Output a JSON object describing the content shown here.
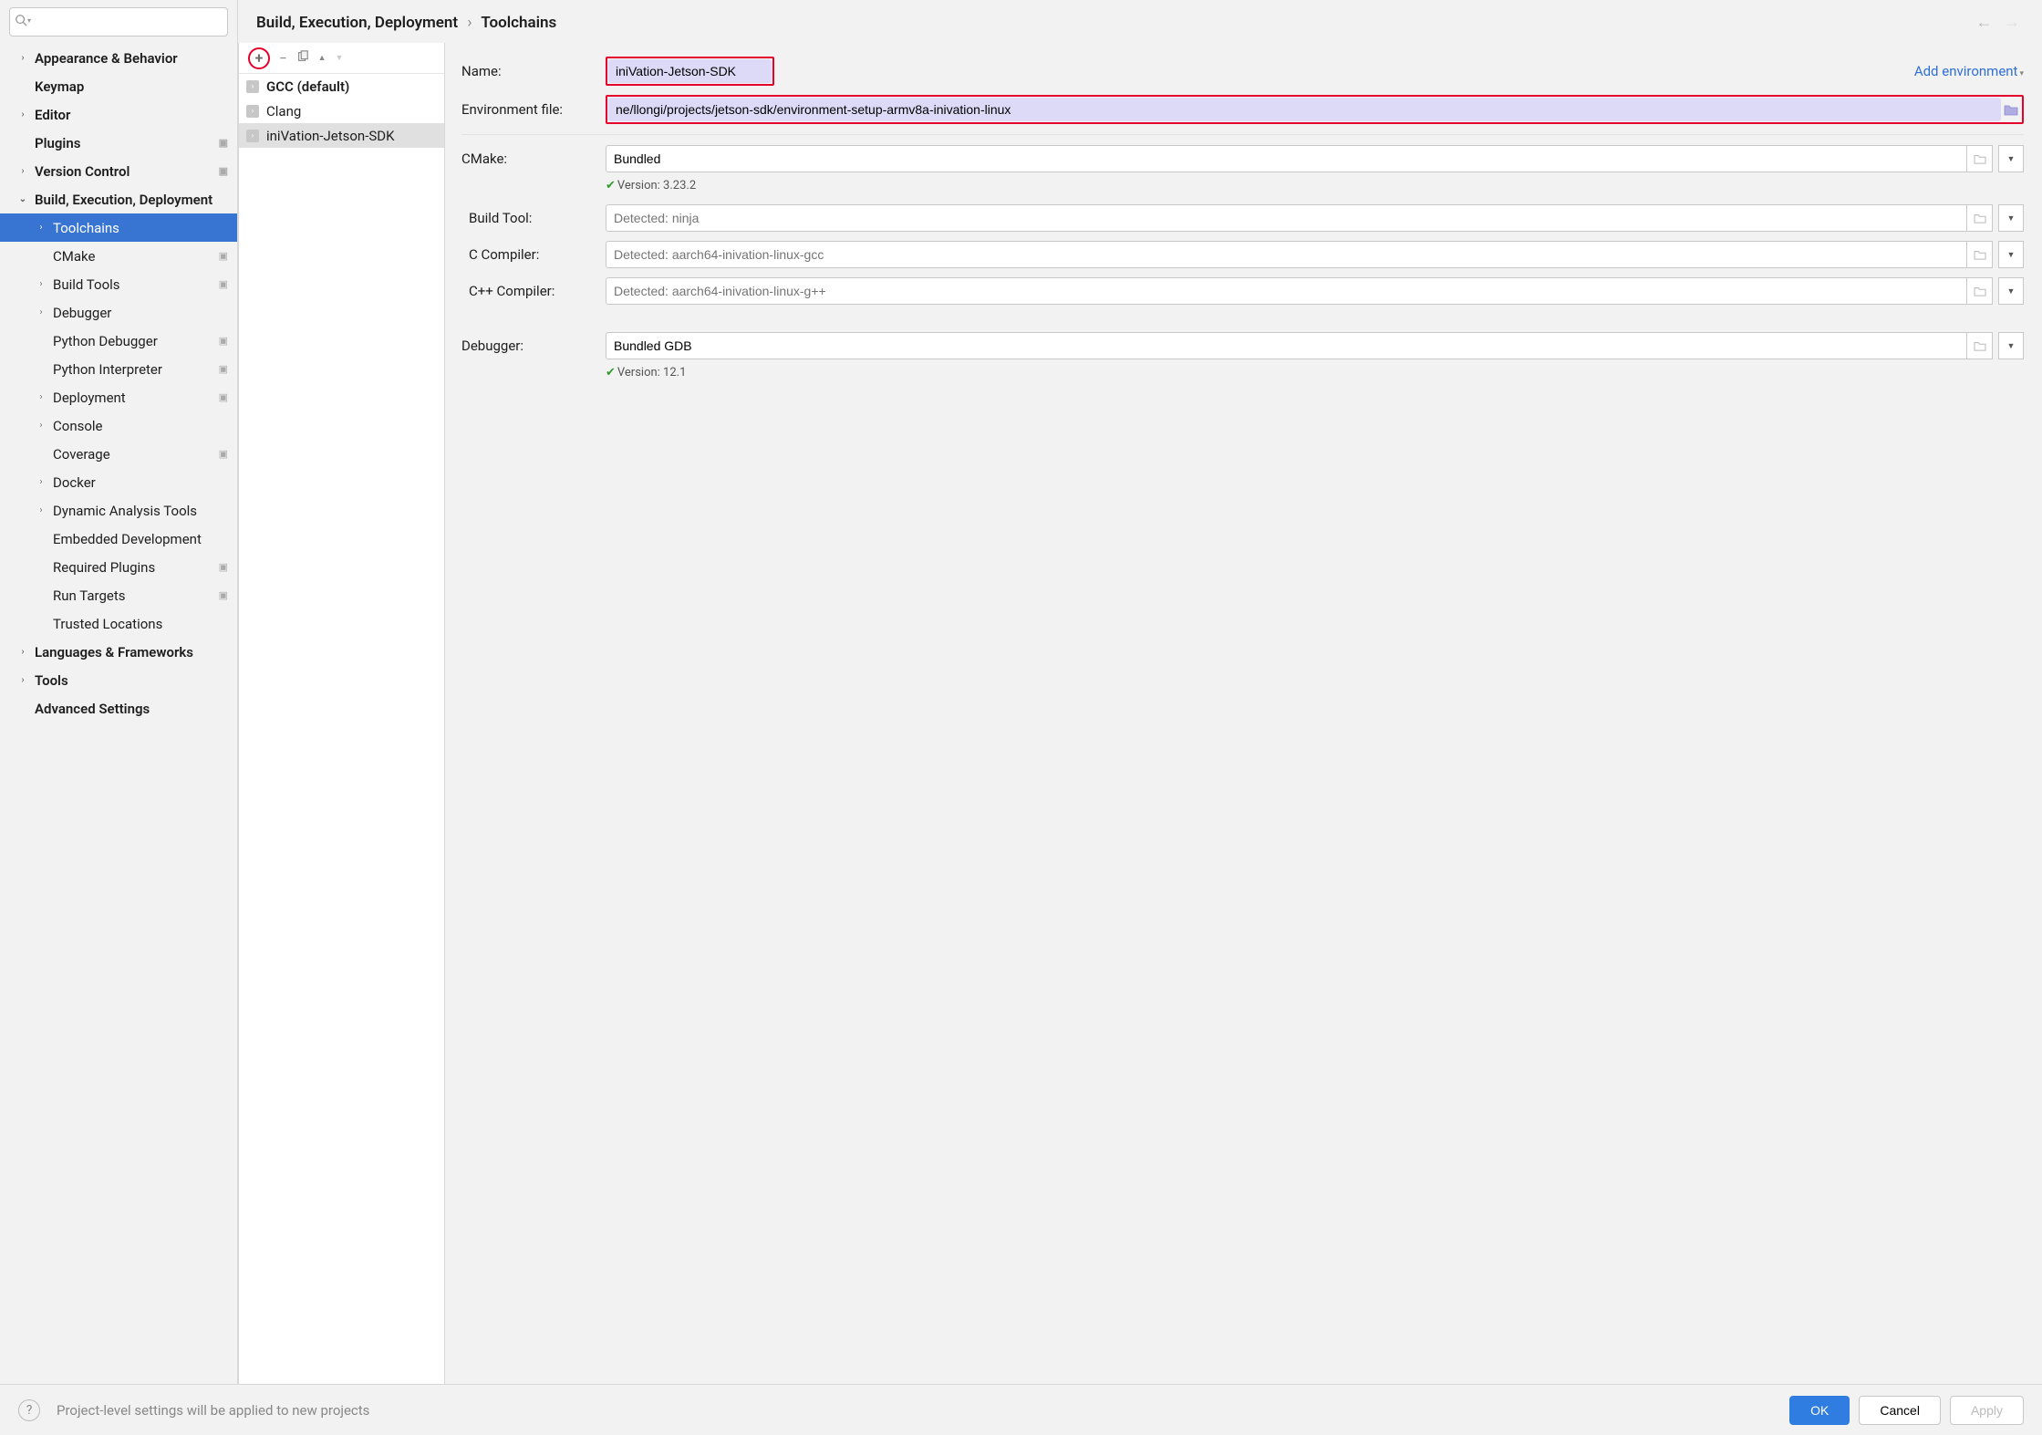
{
  "breadcrumb": {
    "group": "Build, Execution, Deployment",
    "page": "Toolchains"
  },
  "sidebar": {
    "items": [
      {
        "label": "Appearance & Behavior",
        "bold": true,
        "chev": ">"
      },
      {
        "label": "Keymap",
        "bold": true
      },
      {
        "label": "Editor",
        "bold": true,
        "chev": ">"
      },
      {
        "label": "Plugins",
        "bold": true,
        "cfg": true
      },
      {
        "label": "Version Control",
        "bold": true,
        "chev": ">",
        "cfg": true
      },
      {
        "label": "Build, Execution, Deployment",
        "bold": true,
        "chev": "v"
      },
      {
        "label": "Toolchains",
        "nested": true,
        "chev": ">",
        "selected": true
      },
      {
        "label": "CMake",
        "nested": true,
        "cfg": true
      },
      {
        "label": "Build Tools",
        "nested": true,
        "chev": ">",
        "cfg": true
      },
      {
        "label": "Debugger",
        "nested": true,
        "chev": ">"
      },
      {
        "label": "Python Debugger",
        "nested": true,
        "cfg": true
      },
      {
        "label": "Python Interpreter",
        "nested": true,
        "cfg": true
      },
      {
        "label": "Deployment",
        "nested": true,
        "chev": ">",
        "cfg": true
      },
      {
        "label": "Console",
        "nested": true,
        "chev": ">"
      },
      {
        "label": "Coverage",
        "nested": true,
        "cfg": true
      },
      {
        "label": "Docker",
        "nested": true,
        "chev": ">"
      },
      {
        "label": "Dynamic Analysis Tools",
        "nested": true,
        "chev": ">"
      },
      {
        "label": "Embedded Development",
        "nested": true
      },
      {
        "label": "Required Plugins",
        "nested": true,
        "cfg": true
      },
      {
        "label": "Run Targets",
        "nested": true,
        "cfg": true
      },
      {
        "label": "Trusted Locations",
        "nested": true
      },
      {
        "label": "Languages & Frameworks",
        "bold": true,
        "chev": ">"
      },
      {
        "label": "Tools",
        "bold": true,
        "chev": ">"
      },
      {
        "label": "Advanced Settings",
        "bold": true
      }
    ]
  },
  "toolchains": {
    "items": [
      {
        "label": "GCC (default)",
        "default": true
      },
      {
        "label": "Clang"
      },
      {
        "label": "iniVation-Jetson-SDK",
        "selected": true
      }
    ]
  },
  "form": {
    "name_label": "Name:",
    "name_value": "iniVation-Jetson-SDK",
    "add_env": "Add environment",
    "env_label": "Environment file:",
    "env_value": "ne/llongi/projects/jetson-sdk/environment-setup-armv8a-inivation-linux",
    "cmake_label": "CMake:",
    "cmake_value": "Bundled",
    "cmake_version": "Version: 3.23.2",
    "build_label": "Build Tool:",
    "build_placeholder": "Detected: ninja",
    "cc_label": "C Compiler:",
    "cc_placeholder": "Detected: aarch64-inivation-linux-gcc",
    "cxx_label": "C++ Compiler:",
    "cxx_placeholder": "Detected: aarch64-inivation-linux-g++",
    "dbg_label": "Debugger:",
    "dbg_value": "Bundled GDB",
    "dbg_version": "Version: 12.1"
  },
  "footer": {
    "note": "Project-level settings will be applied to new projects",
    "ok": "OK",
    "cancel": "Cancel",
    "apply": "Apply"
  }
}
